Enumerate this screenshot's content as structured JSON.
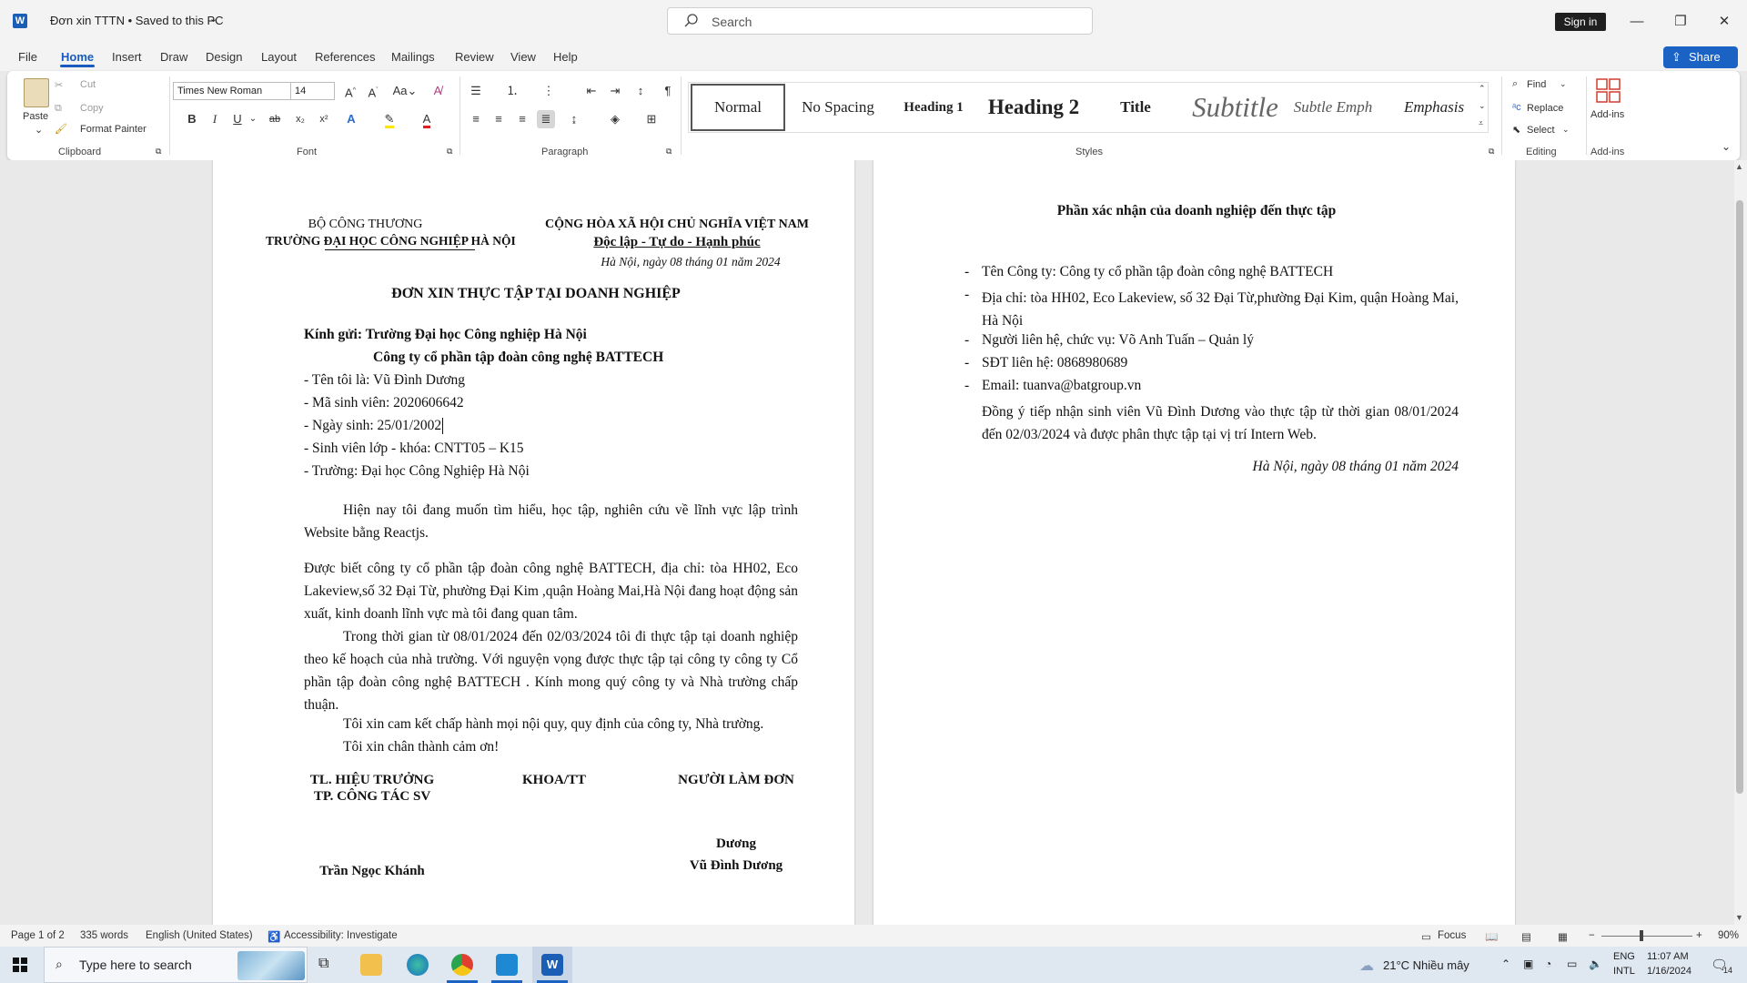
{
  "titlebar": {
    "app_icon": "word-logo-icon",
    "doc_title": "Đơn xin TTTN  •  Saved to this PC",
    "search_placeholder": "Search",
    "sign_in": "Sign in",
    "minimize": "—",
    "restore": "❐",
    "close": "✕"
  },
  "menu": {
    "items": [
      "File",
      "Home",
      "Insert",
      "Draw",
      "Design",
      "Layout",
      "References",
      "Mailings",
      "Review",
      "View",
      "Help"
    ],
    "share": "Share"
  },
  "ribbon": {
    "clipboard": {
      "label": "Clipboard",
      "paste": "Paste",
      "cut": "Cut",
      "copy": "Copy",
      "format_painter": "Format Painter"
    },
    "font": {
      "label": "Font",
      "family": "Times New Roman",
      "size": "14",
      "bold": "B",
      "italic": "I",
      "underline": "U",
      "strike": "ab",
      "subscript": "x₂",
      "superscript": "x²"
    },
    "paragraph": {
      "label": "Paragraph"
    },
    "styles": {
      "label": "Styles",
      "items": [
        "Normal",
        "No Spacing",
        "Heading 1",
        "Heading 2",
        "Title",
        "Subtitle",
        "Subtle Emph",
        "Emphasis"
      ]
    },
    "editing": {
      "label": "Editing",
      "find": "Find",
      "replace": "Replace",
      "select": "Select"
    },
    "addins": {
      "label": "Add-ins",
      "button": "Add-ins"
    }
  },
  "page1": {
    "left_header_1": "BỘ CÔNG THƯƠNG",
    "left_header_2": "TRƯỜNG ĐẠI HỌC CÔNG NGHIỆP HÀ NỘI",
    "right_header_1": "CỘNG HÒA XÃ HỘI CHỦ NGHĨA VIỆT NAM",
    "right_header_2": "Độc lập - Tự do - Hạnh phúc",
    "date": "Hà Nội, ngày 08  tháng 01 năm 2024",
    "title": "ĐƠN XIN THỰC TẬP TẠI DOANH NGHIỆP",
    "to_1": "Kính gửi: Trường Đại học Công nghiệp Hà Nội",
    "to_2": "Công ty cổ phần tập đoàn công nghệ BATTECH",
    "info": [
      "- Tên tôi là: Vũ Đình Dương",
      "- Mã sinh viên: 2020606642",
      "- Ngày sinh: 25/01/2002",
      "- Sinh viên lớp - khóa: CNTT05 – K15",
      "- Trường: Đại học Công Nghiệp Hà Nội"
    ],
    "para1": "Hiện nay tôi đang muốn tìm hiểu, học tập, nghiên cứu về lĩnh vực lập trình Website bằng Reactjs.",
    "para2": "Được biết công ty cổ phần tập đoàn công nghệ BATTECH, địa chỉ:  tòa HH02, Eco Lakeview,số 32  Đại Từ, phường Đại Kim ,quận Hoàng Mai,Hà Nội đang hoạt động sản xuất, kinh doanh lĩnh vực mà tôi đang quan tâm.",
    "para3": "Trong thời gian từ 08/01/2024 đến 02/03/2024 tôi đi thực tập tại doanh nghiệp theo kế hoạch của nhà trường. Với nguyện vọng được thực tập tại công ty công ty Cổ phần tập đoàn công nghệ BATTECH . Kính mong quý công ty và Nhà trường chấp thuận.",
    "para4": "Tôi xin cam kết chấp hành mọi nội quy, quy định của công ty, Nhà trường.",
    "para5": "Tôi xin chân thành cảm ơn!",
    "sig_left_1": "TL. HIỆU TRƯỞNG",
    "sig_left_2": "TP. CÔNG TÁC SV",
    "sig_mid": "KHOA/TT",
    "sig_right": "NGƯỜI LÀM ĐƠN",
    "sig_right_signature": "Dương",
    "sig_right_name": "Vũ Đình Dương",
    "sig_left_name": "Trần Ngọc Khánh"
  },
  "page2": {
    "title": "Phần xác nhận của doanh nghiệp đến thực tập",
    "items": [
      "Tên Công ty: Công ty cổ phần tập đoàn công nghệ BATTECH",
      "Địa chỉ: tòa HH02, Eco Lakeview, số 32 Đại Từ,phường Đại Kim, quận Hoàng Mai, Hà Nội",
      "Người liên hệ, chức vụ: Võ Anh Tuấn – Quản lý",
      "SĐT liên hệ: 0868980689",
      "Email: tuanva@batgroup.vn"
    ],
    "agree": "Đồng ý tiếp nhận sinh viên Vũ Đình Dương vào thực tập từ thời gian 08/01/2024 đến 02/03/2024 và được phân thực tập tại vị trí Intern Web.",
    "date": "Hà Nội, ngày 08  tháng 01 năm 2024"
  },
  "status": {
    "page": "Page 1 of 2",
    "words": "335 words",
    "language": "English (United States)",
    "accessibility": "Accessibility: Investigate",
    "focus": "Focus",
    "zoom": "90%"
  },
  "taskbar": {
    "search_placeholder": "Type here to search",
    "weather": "21°C  Nhiều mây",
    "lang_1": "ENG",
    "lang_2": "INTL",
    "time": "11:07 AM",
    "date": "1/16/2024",
    "notifications": "14"
  }
}
